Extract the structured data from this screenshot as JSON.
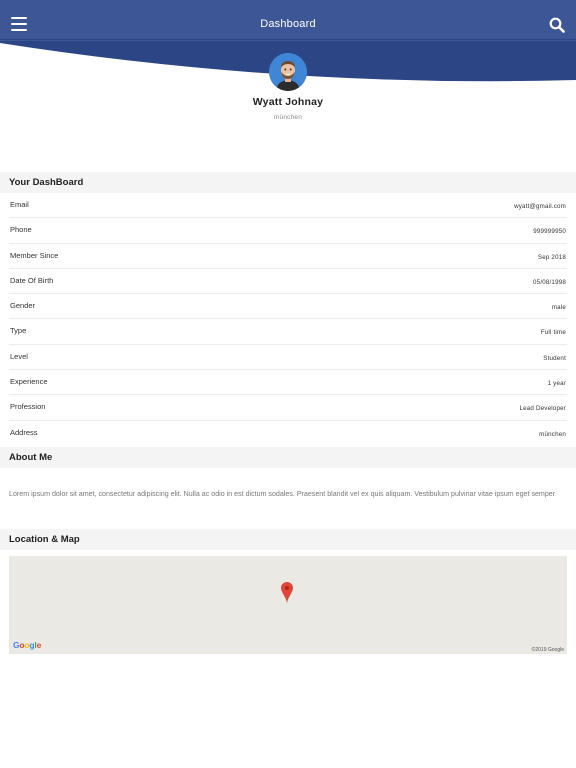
{
  "header": {
    "title": "Dashboard",
    "colors": {
      "bar": "#3d5796",
      "curve": "#2c4585"
    }
  },
  "profile": {
    "name": "Wyatt Johnay",
    "city": "münchen"
  },
  "dashboard": {
    "heading": "Your DashBoard",
    "rows": [
      {
        "label": "Email",
        "value": "wyatt@gmail.com"
      },
      {
        "label": "Phone",
        "value": "999999950"
      },
      {
        "label": "Member Since",
        "value": "Sep 2018"
      },
      {
        "label": "Date Of Birth",
        "value": "05/08/1998"
      },
      {
        "label": "Gender",
        "value": "male"
      },
      {
        "label": "Type",
        "value": "Full time"
      },
      {
        "label": "Level",
        "value": "Student"
      },
      {
        "label": "Experience",
        "value": "1 year"
      },
      {
        "label": "Profession",
        "value": "Lead Developer"
      },
      {
        "label": "Address",
        "value": "münchen"
      }
    ]
  },
  "about": {
    "heading": "About Me",
    "text": "Lorem ipsum dolor sit amet, consectetur adipiscing elit. Nulla ac odio in est dictum sodales. Praesent blandit vel ex quis aliquam. Vestibulum pulvinar vitae ipsum eget semper"
  },
  "location": {
    "heading": "Location & Map",
    "map_logo": "Google",
    "map_copyright": "©2019 Google"
  }
}
